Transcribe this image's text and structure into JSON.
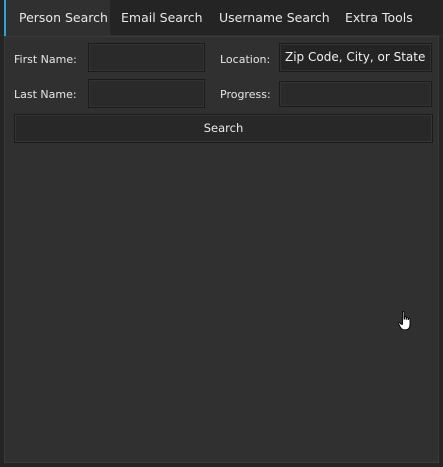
{
  "tabs": [
    {
      "label": "Person Search",
      "active": true
    },
    {
      "label": "Email Search",
      "active": false
    },
    {
      "label": "Username Search",
      "active": false
    },
    {
      "label": "Extra Tools",
      "active": false
    }
  ],
  "form": {
    "first_name_label": "First Name:",
    "first_name_value": "",
    "location_label": "Location:",
    "location_value": "Zip Code, City, or State",
    "last_name_label": "Last Name:",
    "last_name_value": "",
    "progress_label": "Progress:",
    "progress_value": ""
  },
  "search_button_label": "Search",
  "cursor_icon": "hand-pointer-icon",
  "colors": {
    "accent": "#2aa6d6",
    "panel_bg": "#303030",
    "window_bg": "#242424"
  }
}
